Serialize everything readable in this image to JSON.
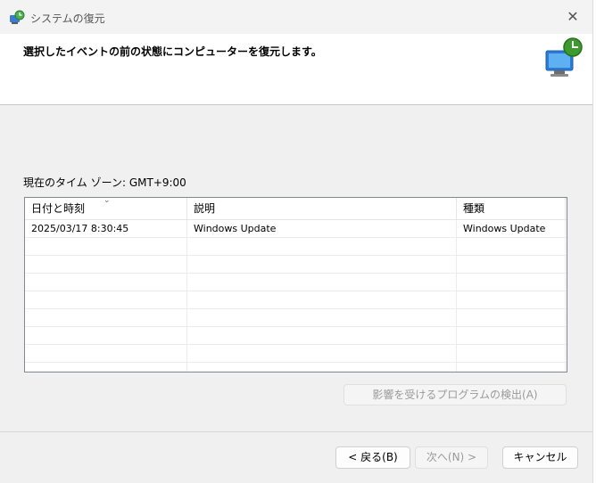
{
  "window": {
    "title": "システムの復元",
    "close_glyph": "✕"
  },
  "header": {
    "instruction": "選択したイベントの前の状態にコンピューターを復元します。"
  },
  "timezone": {
    "label": "現在のタイム ゾーン: GMT+9:00"
  },
  "table": {
    "sort_glyph": "⌄",
    "columns": [
      "日付と時刻",
      "説明",
      "種類"
    ],
    "rows": [
      [
        "2025/03/17 8:30:45",
        "Windows Update",
        "Windows Update"
      ],
      [
        "",
        "",
        ""
      ],
      [
        "",
        "",
        ""
      ],
      [
        "",
        "",
        ""
      ],
      [
        "",
        "",
        ""
      ],
      [
        "",
        "",
        ""
      ],
      [
        "",
        "",
        ""
      ],
      [
        "",
        "",
        ""
      ],
      [
        "",
        "",
        ""
      ]
    ]
  },
  "buttons": {
    "detect": "影響を受けるプログラムの検出(A)",
    "back": "< 戻る(B)",
    "next": "次へ(N) >",
    "cancel": "キャンセル"
  },
  "colors": {
    "accent_blue": "#2a7bd6",
    "accent_green": "#3c9a2f"
  }
}
